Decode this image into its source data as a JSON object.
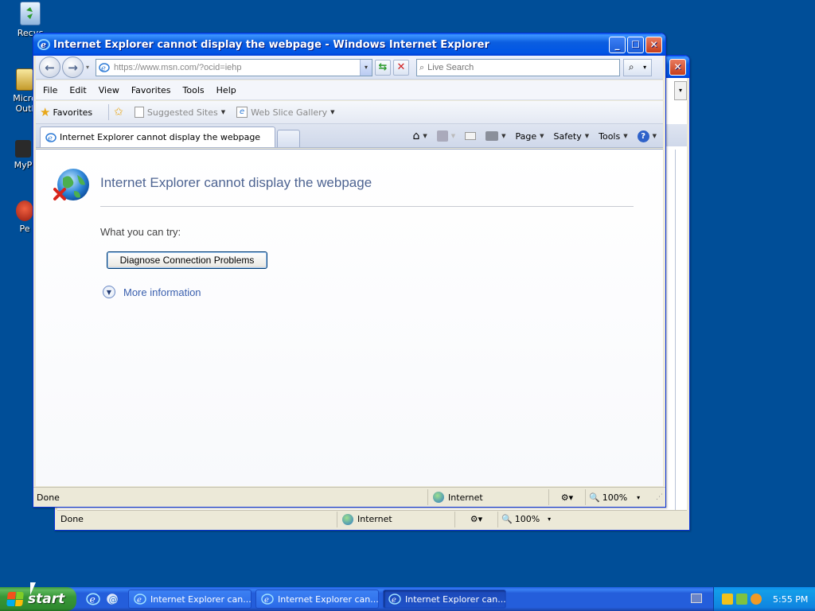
{
  "desktop": {
    "icons": [
      {
        "label": "Recyc"
      },
      {
        "label": "Micro\nOutl"
      },
      {
        "label": "MyP"
      },
      {
        "label": "Pe"
      }
    ]
  },
  "back_window": {
    "status_text": "Done",
    "zone": "Internet",
    "zoom": "100%"
  },
  "window": {
    "title": "Internet Explorer cannot display the webpage - Windows Internet Explorer",
    "address": "https://www.msn.com/?ocid=iehp",
    "search_placeholder": "Live Search",
    "menu": [
      "File",
      "Edit",
      "View",
      "Favorites",
      "Tools",
      "Help"
    ],
    "favorites_bar": {
      "favorites": "Favorites",
      "suggested_sites": "Suggested Sites",
      "web_slice_gallery": "Web Slice Gallery"
    },
    "tab_title": "Internet Explorer cannot display the webpage",
    "command_bar": {
      "page": "Page",
      "safety": "Safety",
      "tools": "Tools"
    },
    "content": {
      "heading": "Internet Explorer cannot display the webpage",
      "try_text": "What you can try:",
      "diagnose_button": "Diagnose Connection Problems",
      "more_info": "More information"
    },
    "status": {
      "text": "Done",
      "zone": "Internet",
      "zoom": "100%"
    }
  },
  "taskbar": {
    "start_label": "start",
    "tasks": [
      {
        "label": "Internet Explorer can..."
      },
      {
        "label": "Internet Explorer can..."
      },
      {
        "label": "Internet Explorer can..."
      }
    ],
    "clock": "5:55 PM"
  },
  "colors": {
    "desktop": "#004e98",
    "title_bar": "#0055e5",
    "heading_text": "#4e6492",
    "link_text": "#3a5fae"
  }
}
